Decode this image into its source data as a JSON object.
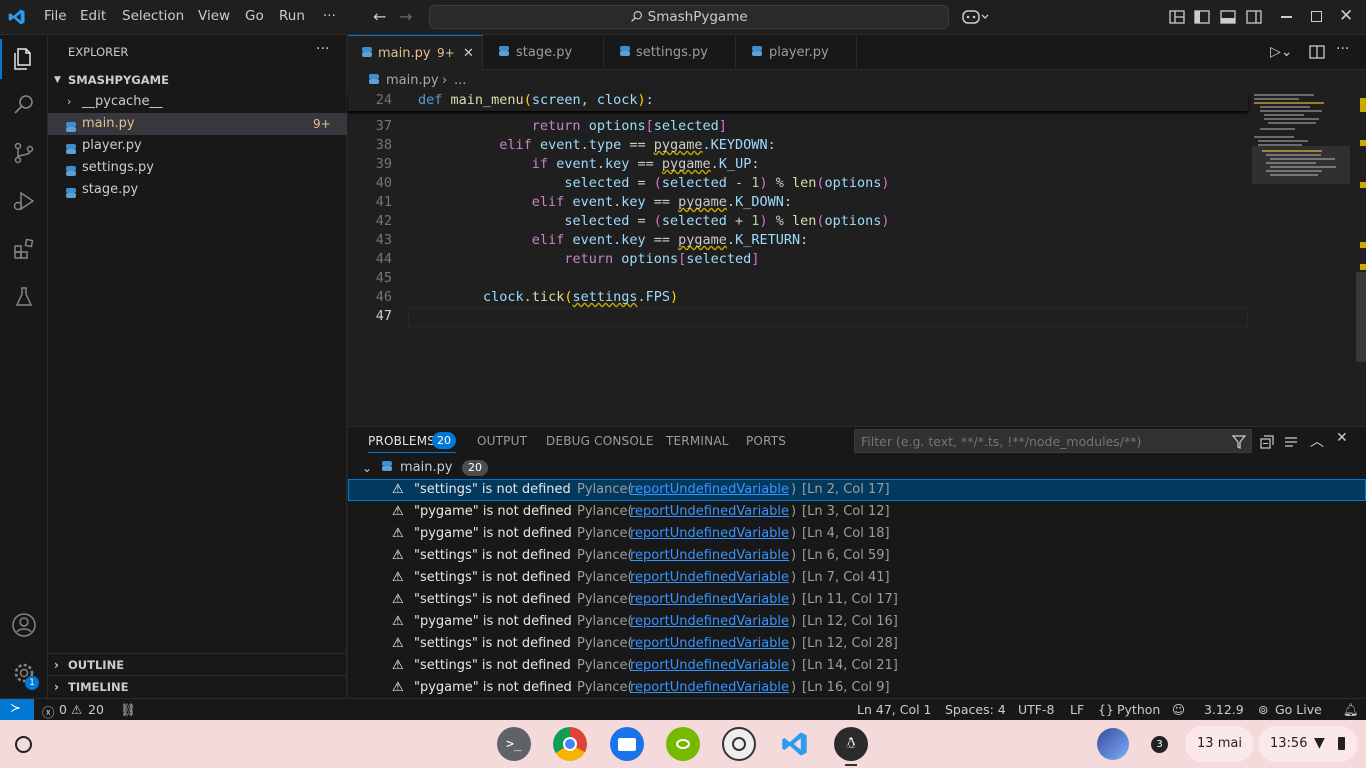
{
  "titlebar": {
    "menus": [
      "File",
      "Edit",
      "Selection",
      "View",
      "Go",
      "Run",
      "···"
    ],
    "search_text": "SmashPygame"
  },
  "sidebar": {
    "header": "EXPLORER",
    "project": "SMASHPYGAME",
    "items": [
      {
        "label": "__pycache__",
        "type": "folder"
      },
      {
        "label": "main.py",
        "type": "py",
        "badge": "9+",
        "selected": true
      },
      {
        "label": "player.py",
        "type": "py"
      },
      {
        "label": "settings.py",
        "type": "py"
      },
      {
        "label": "stage.py",
        "type": "py"
      }
    ],
    "outline": "OUTLINE",
    "timeline": "TIMELINE"
  },
  "tabs": [
    {
      "label": "main.py",
      "badge": "9+",
      "active": true
    },
    {
      "label": "stage.py"
    },
    {
      "label": "settings.py"
    },
    {
      "label": "player.py"
    }
  ],
  "breadcrumb": {
    "file": "main.py",
    "rest": "..."
  },
  "code": {
    "sticky_number": "24",
    "numbers": [
      "37",
      "38",
      "39",
      "40",
      "41",
      "42",
      "43",
      "44",
      "45",
      "46",
      "47"
    ]
  },
  "panel": {
    "tabs": [
      "PROBLEMS",
      "OUTPUT",
      "DEBUG CONSOLE",
      "TERMINAL",
      "PORTS"
    ],
    "problems_count": "20",
    "filter_placeholder": "Filter (e.g. text, **/*.ts, !**/node_modules/**)",
    "group_file": "main.py",
    "group_count": "20",
    "problems": [
      {
        "msg": "\"settings\" is not defined",
        "src": "Pylance(",
        "code": "reportUndefinedVariable",
        "close": ")",
        "loc": "[Ln 2, Col 17]"
      },
      {
        "msg": "\"pygame\" is not defined",
        "src": "Pylance(",
        "code": "reportUndefinedVariable",
        "close": ")",
        "loc": "[Ln 3, Col 12]"
      },
      {
        "msg": "\"pygame\" is not defined",
        "src": "Pylance(",
        "code": "reportUndefinedVariable",
        "close": ")",
        "loc": "[Ln 4, Col 18]"
      },
      {
        "msg": "\"settings\" is not defined",
        "src": "Pylance(",
        "code": "reportUndefinedVariable",
        "close": ")",
        "loc": "[Ln 6, Col 59]"
      },
      {
        "msg": "\"settings\" is not defined",
        "src": "Pylance(",
        "code": "reportUndefinedVariable",
        "close": ")",
        "loc": "[Ln 7, Col 41]"
      },
      {
        "msg": "\"settings\" is not defined",
        "src": "Pylance(",
        "code": "reportUndefinedVariable",
        "close": ")",
        "loc": "[Ln 11, Col 17]"
      },
      {
        "msg": "\"pygame\" is not defined",
        "src": "Pylance(",
        "code": "reportUndefinedVariable",
        "close": ")",
        "loc": "[Ln 12, Col 16]"
      },
      {
        "msg": "\"settings\" is not defined",
        "src": "Pylance(",
        "code": "reportUndefinedVariable",
        "close": ")",
        "loc": "[Ln 12, Col 28]"
      },
      {
        "msg": "\"settings\" is not defined",
        "src": "Pylance(",
        "code": "reportUndefinedVariable",
        "close": ")",
        "loc": "[Ln 14, Col 21]"
      },
      {
        "msg": "\"pygame\" is not defined",
        "src": "Pylance(",
        "code": "reportUndefinedVariable",
        "close": ")",
        "loc": "[Ln 16, Col 9]"
      }
    ]
  },
  "statusbar": {
    "errors": "0",
    "warnings": "20",
    "position": "Ln 47, Col 1",
    "spaces": "Spaces: 4",
    "encoding": "UTF-8",
    "eol": "LF",
    "language": "Python",
    "version": "3.12.9",
    "golive": "Go Live"
  },
  "taskbar": {
    "notif_count": "3",
    "date": "13 mai",
    "time": "13:56"
  },
  "activity_badge": "1",
  "colors": {
    "accent": "#0078d4",
    "warning": "#cca700",
    "link": "#3794ff",
    "taskbar": "#f4dada"
  }
}
